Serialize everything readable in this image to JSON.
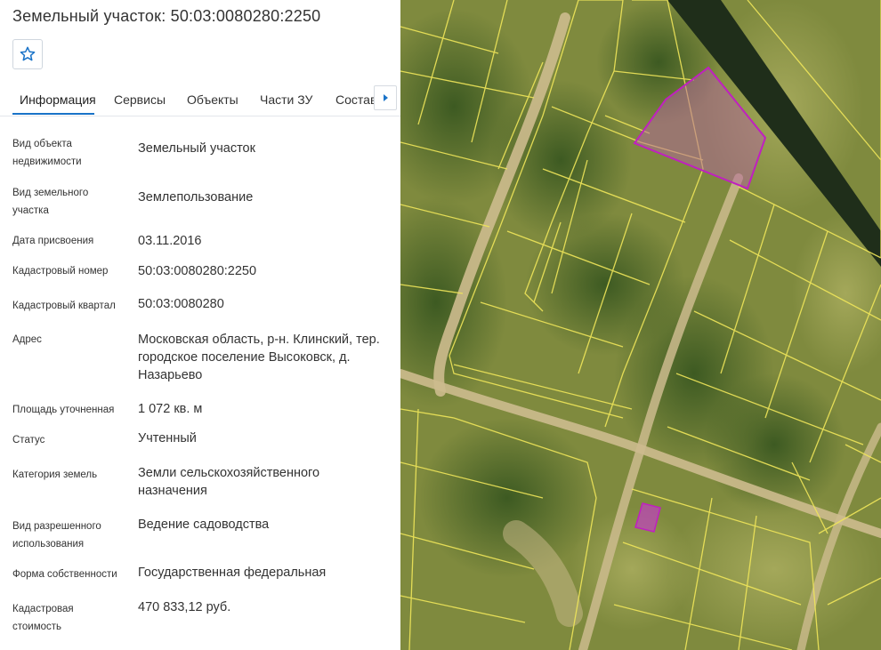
{
  "title": "Земельный участок: 50:03:0080280:2250",
  "tabs": [
    {
      "label": "Информация"
    },
    {
      "label": "Сервисы"
    },
    {
      "label": "Объекты"
    },
    {
      "label": "Части ЗУ"
    },
    {
      "label": "Состав"
    }
  ],
  "fields": [
    {
      "label": "Вид объекта недвижимости",
      "value": "Земельный участок"
    },
    {
      "label": "Вид земельного участка",
      "value": "Землепользование"
    },
    {
      "label": "Дата присвоения",
      "value": "03.11.2016"
    },
    {
      "label": "Кадастровый номер",
      "value": "50:03:0080280:2250"
    },
    {
      "label": "Кадастровый квартал",
      "value": "50:03:0080280"
    },
    {
      "label": "Адрес",
      "value": "Московская область, р-н. Клинский, тер. городское поселение Высоковск, д. Назарьево"
    },
    {
      "label": "Площадь уточненная",
      "value": "1 072 кв. м"
    },
    {
      "label": "Статус",
      "value": "Учтенный"
    },
    {
      "label": "Категория земель",
      "value": "Земли сельскохозяйственного назначения"
    },
    {
      "label": "Вид разрешенного использования",
      "value": "Ведение садоводства"
    },
    {
      "label": "Форма собственности",
      "value": "Государственная федеральная"
    },
    {
      "label": "Кадастровая стоимость",
      "value": "470 833,12 руб."
    }
  ],
  "icons": {
    "favorite": "star-icon",
    "tabs_scroll": "caret-right-icon"
  },
  "colors": {
    "accent": "#1a73c8",
    "parcel_outline": "#c020c0",
    "cadastral_lines": "#f0e65a"
  }
}
